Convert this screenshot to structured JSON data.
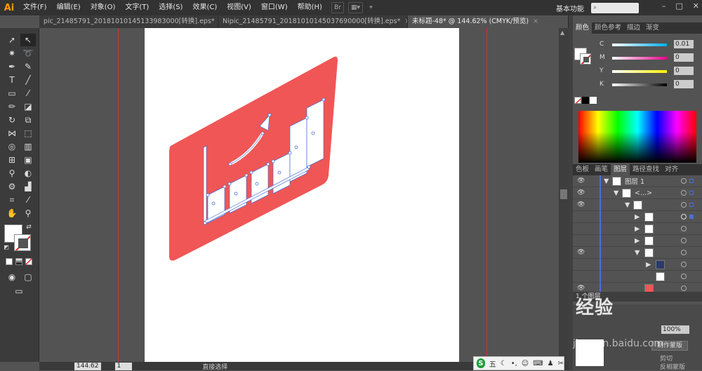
{
  "app": {
    "logo": "Ai"
  },
  "menu": [
    "文件(F)",
    "编辑(E)",
    "对象(O)",
    "文字(T)",
    "选择(S)",
    "效果(C)",
    "视图(V)",
    "窗口(W)",
    "帮助(H)"
  ],
  "workspace_label": "基本功能",
  "tabs": [
    {
      "label": "pic_21485791_20181010145133983000[转换].eps*",
      "close": "×"
    },
    {
      "label": "Nipic_21485791_20181010145037690000[转换].eps*",
      "close": "×"
    },
    {
      "label": "未标题-48* @ 144.62% (CMYK/预览)",
      "close": "×"
    }
  ],
  "status": {
    "zoom": "144.62",
    "page": "1",
    "tool": "直接选择"
  },
  "ime": {
    "label": "五"
  },
  "panels": {
    "color_tabs": [
      "颜色",
      "颜色参考",
      "描边",
      "渐变"
    ],
    "channels": [
      {
        "name": "C",
        "value": "0.01",
        "color": "#00aeef"
      },
      {
        "name": "M",
        "value": "0",
        "color": "#ec008c"
      },
      {
        "name": "Y",
        "value": "0",
        "color": "#fff200"
      },
      {
        "name": "K",
        "value": "0",
        "color": "#000000"
      }
    ],
    "layer_tabs": [
      "色板",
      "画笔",
      "图层",
      "路径查找",
      "对齐"
    ],
    "layers": [
      {
        "name": "图层 1"
      },
      {
        "name": "<...>"
      }
    ],
    "layers_footer": "1 个图层",
    "bottom": {
      "opacity": "100%",
      "btn_mask": "制作蒙版",
      "clip": "剪切",
      "invert": "反相蒙版"
    }
  },
  "colors": {
    "accent": "#f05656",
    "anchor": "#4a6fd6"
  },
  "watermark": {
    "text": "经验",
    "sub": "jingyan.baidu.com"
  }
}
